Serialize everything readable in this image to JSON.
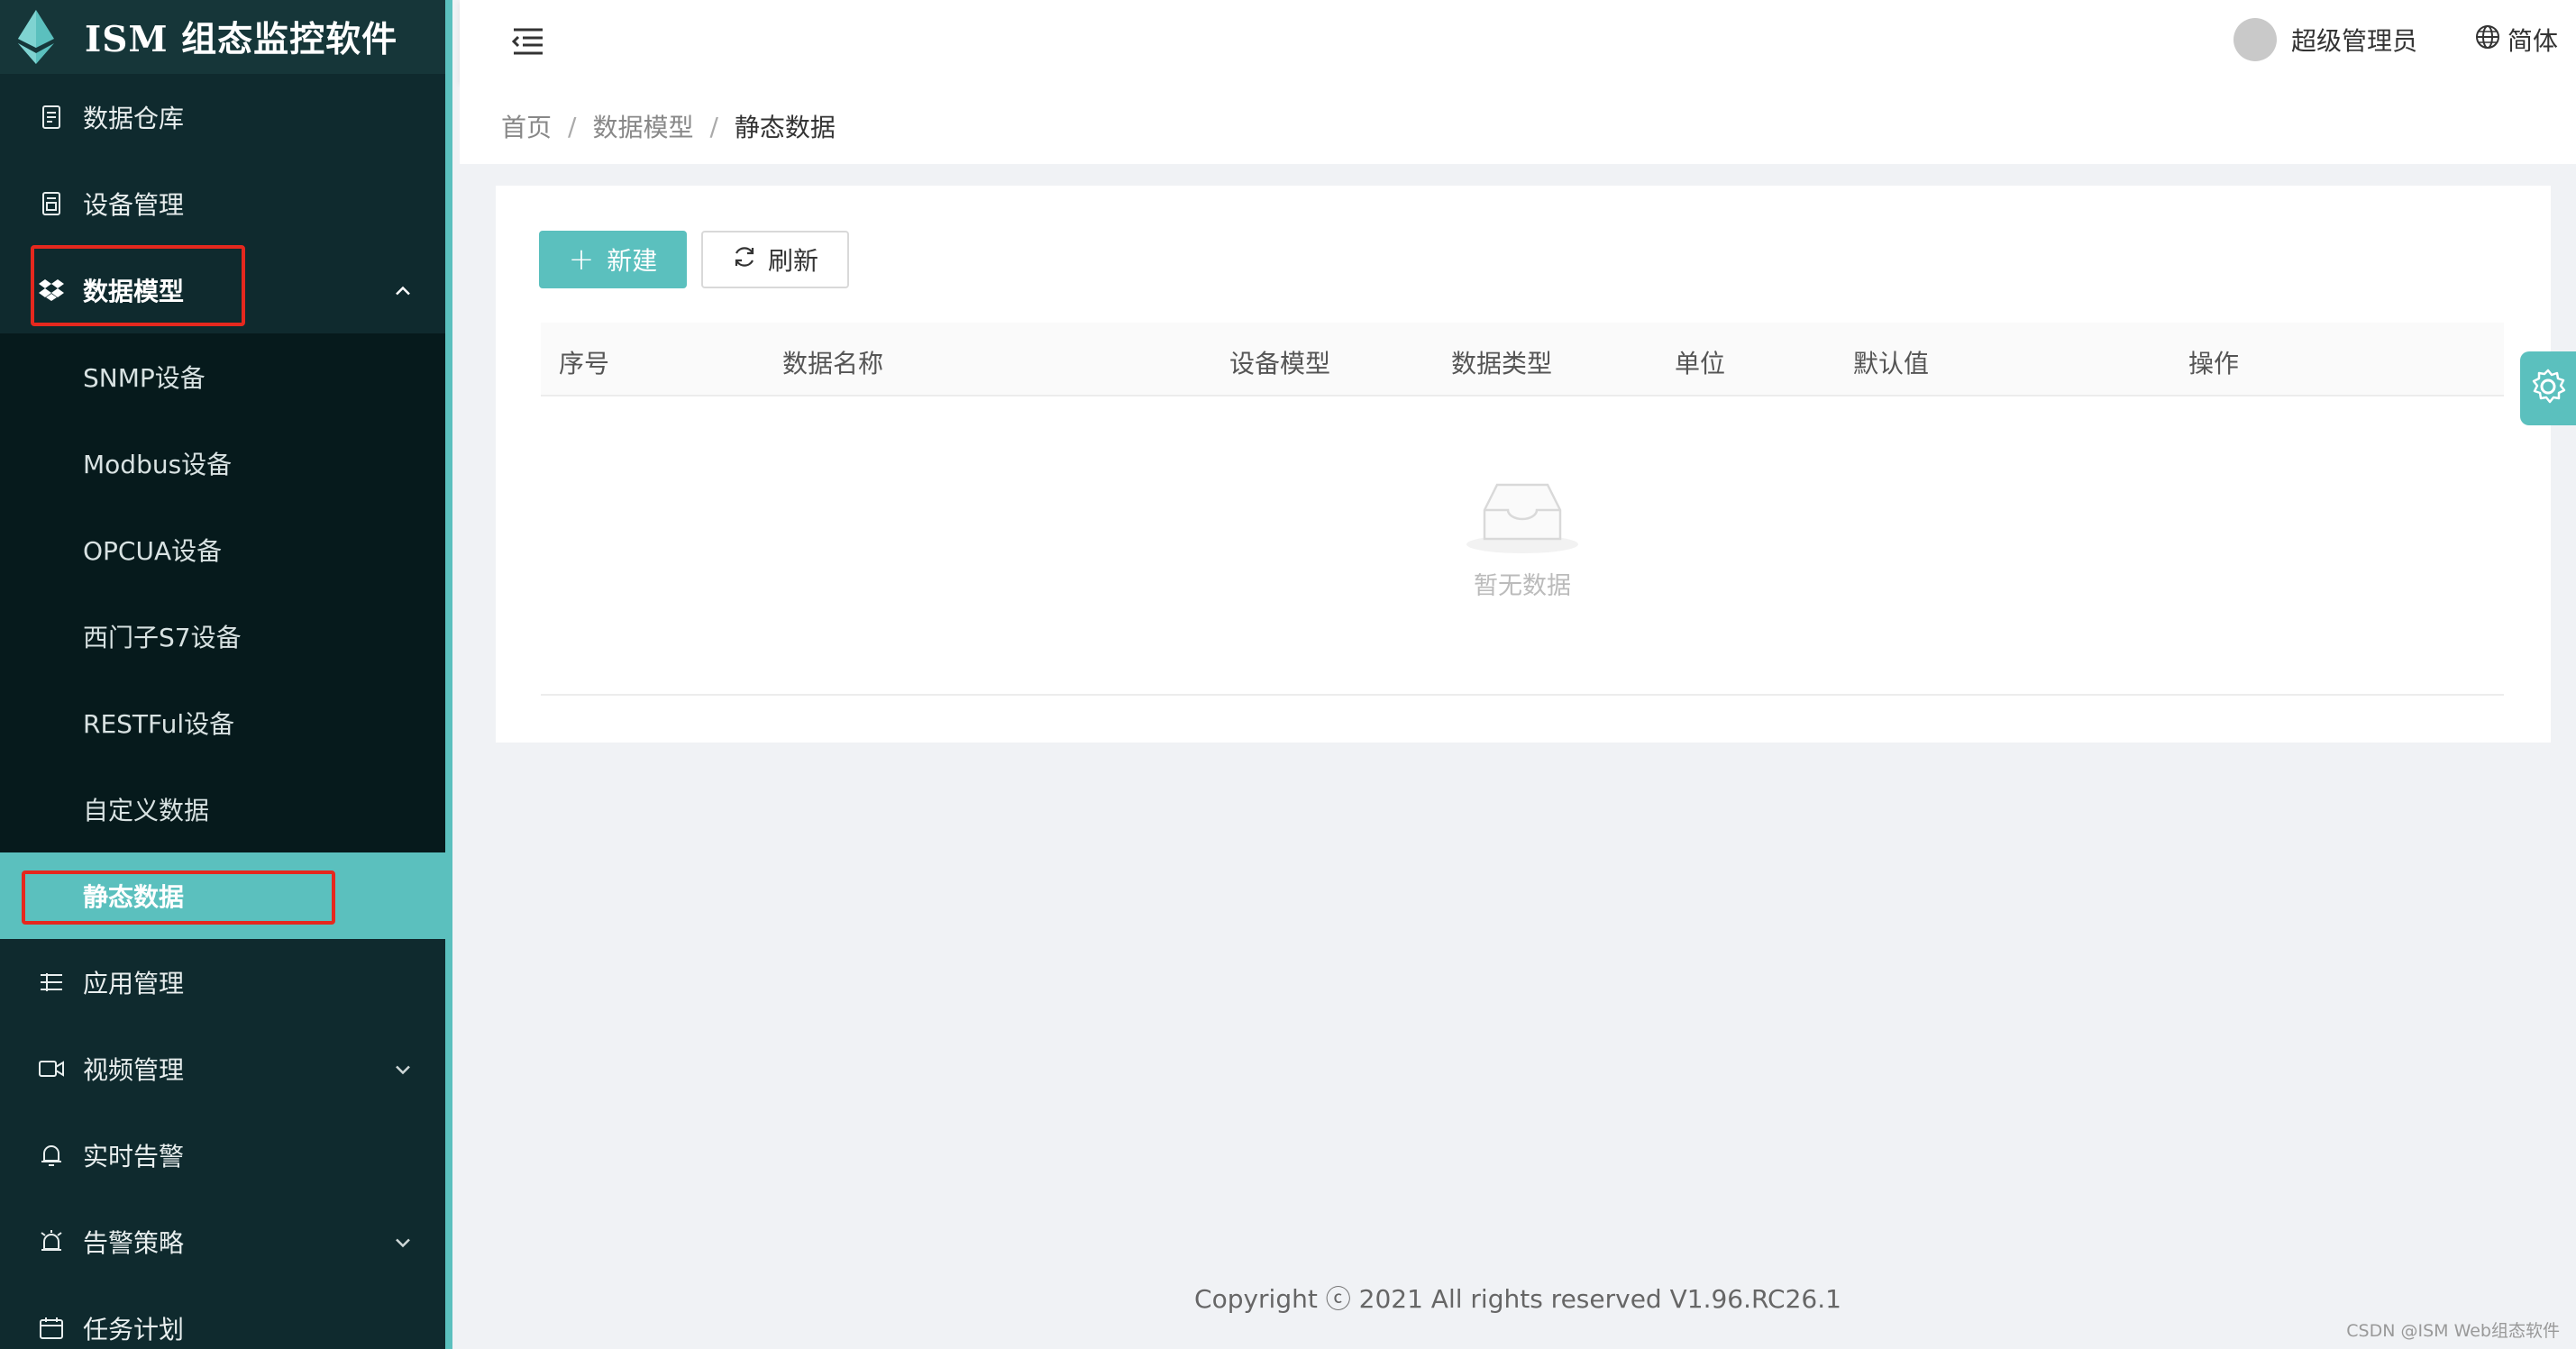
{
  "app": {
    "title": "ISM 组态监控软件"
  },
  "sidebar": {
    "items": [
      {
        "label": "数据仓库",
        "icon": "document-icon"
      },
      {
        "label": "设备管理",
        "icon": "device-icon"
      },
      {
        "label": "数据模型",
        "icon": "dropbox-icon",
        "expanded": true
      },
      {
        "label": "应用管理",
        "icon": "list-icon"
      },
      {
        "label": "视频管理",
        "icon": "video-icon"
      },
      {
        "label": "实时告警",
        "icon": "bell-icon"
      },
      {
        "label": "告警策略",
        "icon": "alarm-icon"
      },
      {
        "label": "任务计划",
        "icon": "calendar-icon"
      }
    ],
    "submenu": [
      {
        "label": "SNMP设备"
      },
      {
        "label": "Modbus设备"
      },
      {
        "label": "OPCUA设备"
      },
      {
        "label": "西门子S7设备"
      },
      {
        "label": "RESTFul设备"
      },
      {
        "label": "自定义数据"
      },
      {
        "label": "静态数据",
        "active": true
      }
    ]
  },
  "header": {
    "user": "超级管理员",
    "language": "简体"
  },
  "breadcrumb": {
    "items": [
      "首页",
      "数据模型",
      "静态数据"
    ],
    "separator": "/"
  },
  "toolbar": {
    "new_label": "新建",
    "refresh_label": "刷新"
  },
  "table": {
    "columns": [
      "序号",
      "数据名称",
      "设备模型",
      "数据类型",
      "单位",
      "默认值",
      "操作"
    ],
    "rows": [],
    "empty_text": "暂无数据"
  },
  "footer": {
    "copyright": "Copyright ⓒ 2021 All rights reserved V1.96.RC26.1"
  },
  "watermark": "CSDN @ISM Web组态软件",
  "colors": {
    "accent": "#5bc0be",
    "sidebar_bg": "#0f2a2e",
    "highlight": "#e5281e"
  }
}
